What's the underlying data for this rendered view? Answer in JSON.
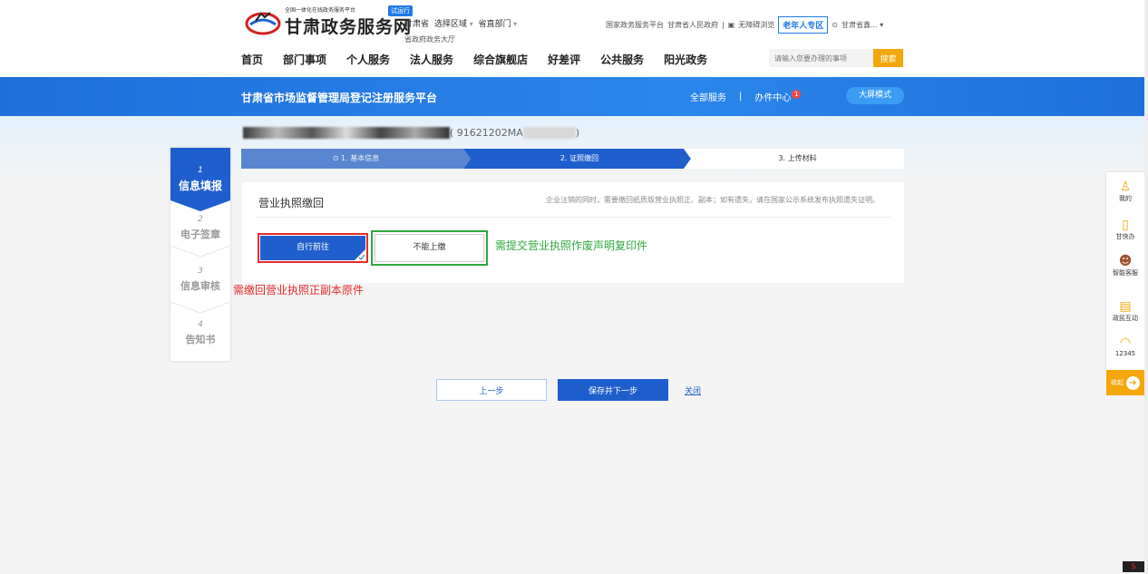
{
  "header": {
    "logo_sub": "全国一体化在线政务服务平台",
    "logo_main": "甘肃政务服务网",
    "trial_badge": "试运行",
    "region": {
      "province": "甘肃省",
      "select_region": "选择区域",
      "select_dept": "省直部门"
    },
    "hall_link": "省政府政务大厅",
    "top_links": [
      "国家政务服务平台",
      "甘肃省人民政府",
      "|",
      "无障碍浏览"
    ],
    "elder_zone": "老年人专区",
    "user": "甘肃省鑫..."
  },
  "nav": {
    "items": [
      "首页",
      "部门事项",
      "个人服务",
      "法人服务",
      "综合旗舰店",
      "好差评",
      "公共服务",
      "阳光政务"
    ],
    "search_placeholder": "请输入您要办理的事项",
    "search_button": "搜索"
  },
  "banner": {
    "title": "甘肃省市场监督管理局登记注册服务平台",
    "all_services": "全部服务",
    "separator": "|",
    "office_center": "办件中心",
    "office_badge": "1",
    "big_screen": "大屏模式"
  },
  "company": {
    "id_prefix": "( 91621202MA",
    "id_suffix": " )"
  },
  "steps": [
    {
      "label": "⊙ 1. 基本信息",
      "state": "done"
    },
    {
      "label": "2. 证照缴回",
      "state": "active"
    },
    {
      "label": "3. 上传材料",
      "state": "todo"
    }
  ],
  "sidebar": {
    "items": [
      {
        "num": "1",
        "label": "信息填报"
      },
      {
        "num": "2",
        "label": "电子签章"
      },
      {
        "num": "3",
        "label": "信息审核"
      },
      {
        "num": "4",
        "label": "告知书"
      }
    ]
  },
  "card": {
    "title": "营业执照缴回",
    "note": "企业注销的同时，需要缴回纸质版营业执照正、副本；如有遗失，请在国家公示系统发布执照遗失证明。",
    "option_self": "自行前往",
    "option_cannot": "不能上缴"
  },
  "annotations": {
    "green": "需提交营业执照作废声明复印件",
    "red": "需缴回营业执照正副本原件"
  },
  "actions": {
    "prev": "上一步",
    "save_next": "保存并下一步",
    "close": "关闭"
  },
  "right_bar": {
    "items": [
      "我的",
      "甘快办",
      "智能客服",
      "政民互动",
      "12345"
    ],
    "collapse": "收起"
  },
  "colors": {
    "primary": "#1f5fcd",
    "accent": "#f4a70a",
    "red": "#e32b2b",
    "green": "#2eaa3f"
  }
}
